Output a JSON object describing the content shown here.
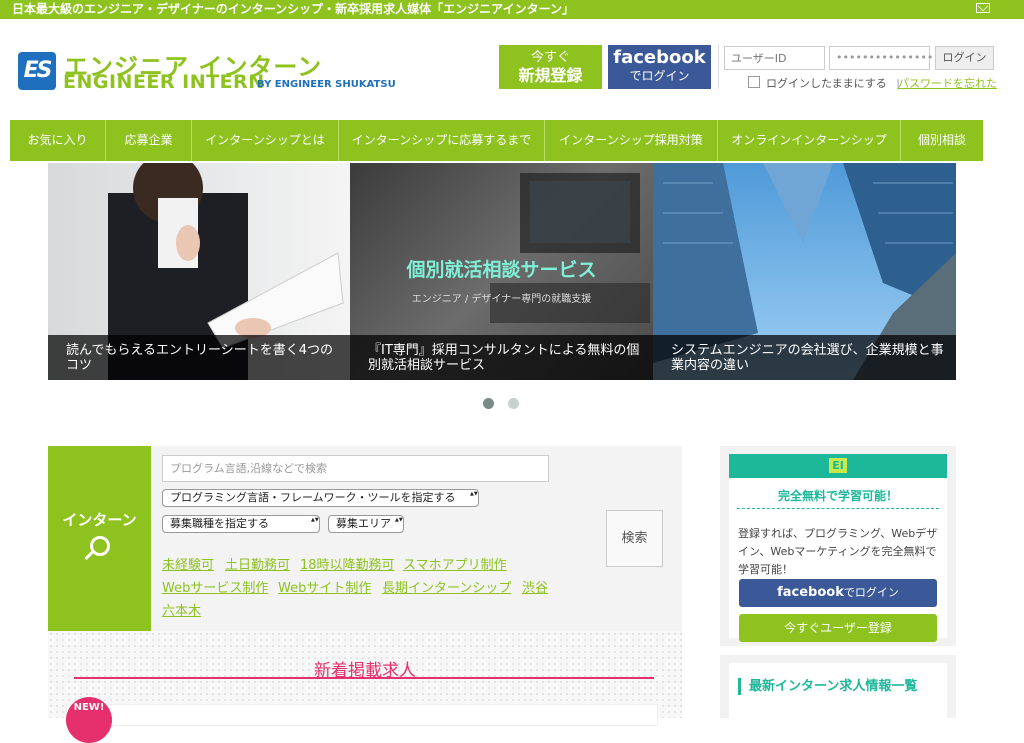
{
  "topbar": {
    "tagline": "日本最大級のエンジニア・デザイナーのインターンシップ・新卒採用求人媒体「エンジニアインターン」",
    "mail_icon": "mail-icon"
  },
  "logo": {
    "mark": "ES",
    "title_jp": "エンジニア インターン",
    "title_en": "ENGINEER INTERN",
    "by": "BY ENGINEER SHUKATSU",
    "brand_color": "#8dc21f",
    "mark_color": "#1e6fbe"
  },
  "header": {
    "signup_line1": "今すぐ",
    "signup_line2": "新規登録",
    "fb_line1": "facebook",
    "fb_line2": "でログイン",
    "user_placeholder": "ユーザーID",
    "password_value": "•••••••••••••••",
    "login_label": "ログイン",
    "remember_label": "ログインしたままにする",
    "separator": "|",
    "forgot_label": "パスワードを忘れた"
  },
  "nav": {
    "items": [
      "お気に入り",
      "応募企業",
      "インターンシップとは",
      "インターンシップに応募するまで",
      "インターンシップ採用対策",
      "オンラインインターンシップ",
      "個別相談"
    ]
  },
  "slider": {
    "slides": [
      {
        "caption": "読んでもらえるエントリーシートを書く4つのコツ"
      },
      {
        "overlay_title": "個別就活相談サービス",
        "overlay_sub": "エンジニア / デザイナー専門の就職支援",
        "caption": "『IT専門』採用コンサルタントによる無料の個別就活相談サービス"
      },
      {
        "caption": "システムエンジニアの会社選び、企業規模と事業内容の違い"
      }
    ],
    "dot_active_color": "#7a8a86",
    "dot_inactive_color": "#c5d3cf"
  },
  "search": {
    "label": "インターン",
    "icon": "magnifier-icon",
    "keyword_placeholder": "プログラム言語,沿線などで検索",
    "select_lang": "プログラミング言語・フレームワーク・ツールを指定する",
    "select_job": "募集職種を指定する",
    "select_area": "募集エリア",
    "button": "検索",
    "tags": [
      "未経験可",
      "土日勤務可",
      "18時以降勤務可",
      "スマホアプリ制作",
      "Webサービス制作",
      "Webサイト制作",
      "長期インターンシップ",
      "渋谷",
      "六本木"
    ]
  },
  "new_jobs": {
    "title": "新着掲載求人",
    "badge": "NEW!",
    "accent": "#e5306d"
  },
  "sidebar": {
    "icon": "ei-logo-icon",
    "icon_text": "EI",
    "free_title": "完全無料で学習可能！",
    "desc": "登録すれば、プログラミング、Webデザイン、Webマーケティングを完全無料で学習可能！",
    "fb_bold": "facebook",
    "fb_rest": "でログイン",
    "register": "今すぐユーザー登録",
    "list_title": "最新インターン求人情報一覧",
    "accent": "#1db89a"
  }
}
